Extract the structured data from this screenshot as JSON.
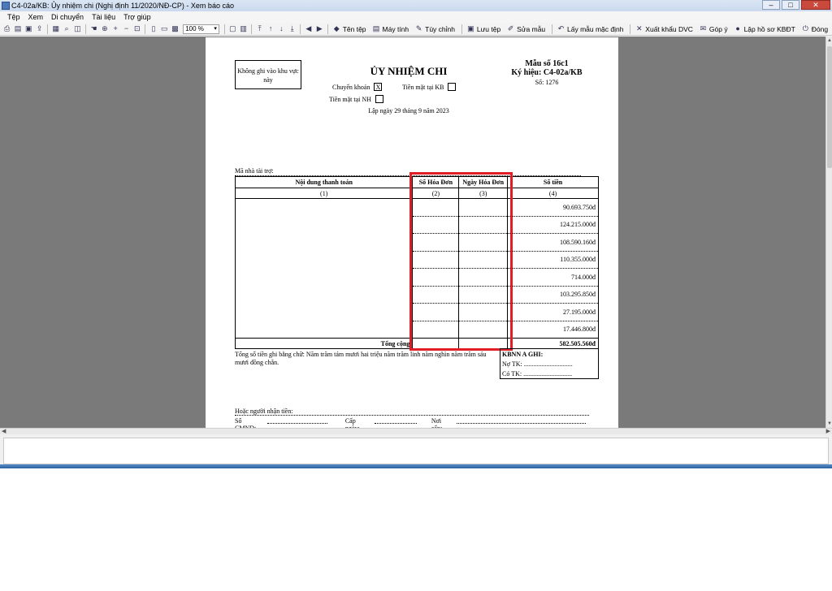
{
  "window": {
    "title": "C4-02a/KB: Ủy nhiệm chi (Nghị định 11/2020/NĐ-CP) - Xem báo cáo",
    "minimize": "–",
    "maximize": "□",
    "close": "✕"
  },
  "menu": [
    "Tệp",
    "Xem",
    "Di chuyển",
    "Tài liệu",
    "Trợ giúp"
  ],
  "toolbar": {
    "zoom_value": "100 %",
    "buttons": [
      "Tên tệp",
      "Máy tính",
      "Tùy chỉnh",
      "Lưu tệp",
      "Sửa mẫu",
      "Lấy mẫu mặc định",
      "Xuất khẩu DVC",
      "Góp ý",
      "Lập hồ sơ KBĐT",
      "Đóng"
    ]
  },
  "document": {
    "no_write_box": "Không ghi vào khu vực này",
    "title": "ỦY NHIỆM CHI",
    "form_no": "Mẫu số 16c1",
    "symbol": "Ký hiệu: C4-02a/KB",
    "serial": "Số: 1276",
    "transfer_label": "Chuyển khoản",
    "transfer_mark": "X",
    "cash_kb_label": "Tiền mặt tại KB",
    "cash_nh_label": "Tiền mặt tại NH",
    "date": "Lập ngày 29 tháng 9 năm 2023",
    "sponsor_label": "Mã nhà tài trợ:",
    "columns": [
      "Nội dung thanh toán",
      "Số Hóa Đơn",
      "Ngày Hóa Đơn",
      "Số tiền"
    ],
    "column_index": [
      "(1)",
      "(2)",
      "(3)",
      "(4)"
    ],
    "amounts": [
      "90.693.750đ",
      "124.215.000đ",
      "108.590.160đ",
      "110.355.000đ",
      "714.000đ",
      "103.295.850đ",
      "27.195.000đ",
      "17.446.800đ"
    ],
    "total_label": "Tổng cộng",
    "total_value": "582.505.560đ",
    "in_words": "Tổng số tiền ghi bằng chữ: Năm trăm tám mươi hai triệu năm trăm linh năm nghìn năm trăm sáu mươi đồng chẵn.",
    "kb_title": "KBNN A GHI:",
    "debit": "Nợ TK: ..............................",
    "credit": "Có TK: ..............................",
    "receiver": "Hoặc người nhận tiền:",
    "id_card": "Số CMND:",
    "issue_date": "Cấp ngày:",
    "issue_place": "Nơi cấp:"
  },
  "colors": {
    "highlight": "#e01e26",
    "viewer_bg": "#7a7a7a"
  }
}
